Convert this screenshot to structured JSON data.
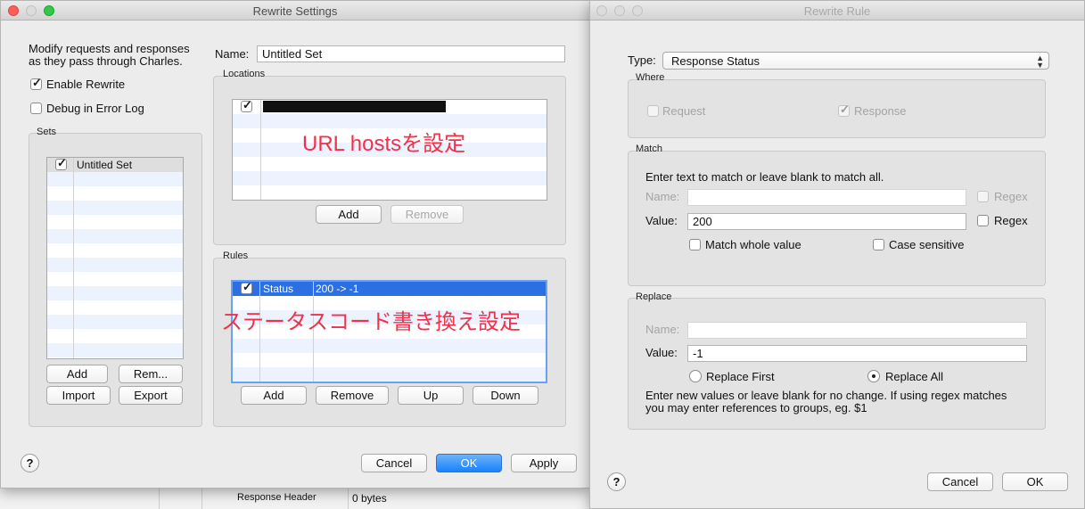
{
  "background": {
    "row_label": "Response Header",
    "row_value": "0 bytes"
  },
  "rewrite_settings": {
    "title": "Rewrite Settings",
    "description": "Modify requests and responses as they pass through Charles.",
    "enable_rewrite": "Enable Rewrite",
    "debug_error_log": "Debug in Error Log",
    "sets_label": "Sets",
    "sets": [
      {
        "name": "Untitled Set",
        "checked": true
      }
    ],
    "add": "Add",
    "remove": "Rem...",
    "import": "Import",
    "export": "Export",
    "name_label": "Name:",
    "name_value": "Untitled Set",
    "locations_label": "Locations",
    "locations_annotation": "URL  hostsを設定",
    "locations_add": "Add",
    "locations_remove": "Remove",
    "rules_label": "Rules",
    "rules": [
      {
        "type": "Status",
        "action": "200 -> -1",
        "checked": true
      }
    ],
    "rules_annotation": "ステータスコード書き換え設定",
    "rules_add": "Add",
    "rules_remove": "Remove",
    "rules_up": "Up",
    "rules_down": "Down",
    "help": "?",
    "cancel": "Cancel",
    "ok": "OK",
    "apply": "Apply"
  },
  "rewrite_rule": {
    "title": "Rewrite Rule",
    "type_label": "Type:",
    "type_value": "Response Status",
    "where_label": "Where",
    "where_request": "Request",
    "where_response": "Response",
    "match_label": "Match",
    "match_instructions": "Enter text to match or leave blank to match all.",
    "match_name_label": "Name:",
    "match_name_value": "",
    "match_value_label": "Value:",
    "match_value": "200",
    "regex": "Regex",
    "match_whole_value": "Match whole value",
    "case_sensitive": "Case sensitive",
    "replace_label": "Replace",
    "replace_name_label": "Name:",
    "replace_name_value": "",
    "replace_value_label": "Value:",
    "replace_value": "-1",
    "replace_first": "Replace First",
    "replace_all": "Replace All",
    "replace_note_1": "Enter new values or leave blank for no change. If using regex matches",
    "replace_note_2": "you may enter references to groups, eg. $1",
    "help": "?",
    "cancel": "Cancel",
    "ok": "OK"
  },
  "colors": {
    "annotation": "#f2304a",
    "selection": "#2b6fe3",
    "primary_button": "#1a82fb"
  }
}
